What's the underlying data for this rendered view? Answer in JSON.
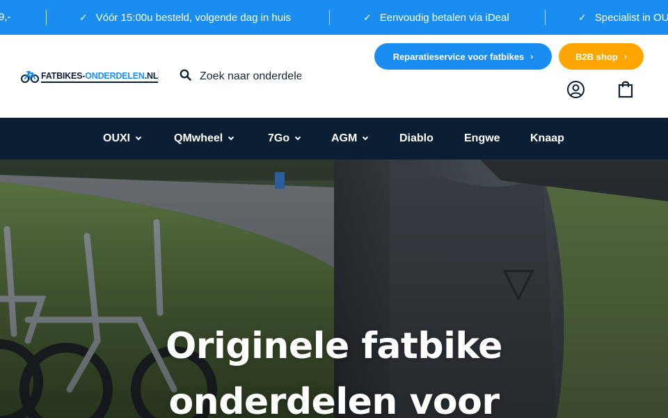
{
  "announcement": {
    "items": [
      {
        "text": "9,-"
      },
      {
        "text": "Vóór 15:00u besteld, volgende dag in huis"
      },
      {
        "text": "Eenvoudig betalen via iDeal"
      },
      {
        "text": "Specialist in OU"
      }
    ],
    "check_glyph": "✓"
  },
  "header": {
    "logo": {
      "text_part1": "FATBIKES-",
      "text_part2": "ONDERDELEN",
      "text_part3": ".NL"
    },
    "search": {
      "placeholder": "Zoek naar onderdelen"
    },
    "buttons": {
      "repair": "Reparatieservice voor fatbikes",
      "b2b": "B2B shop"
    },
    "icons": {
      "search": "search-icon",
      "account": "account-icon",
      "cart": "shopping-bag-icon"
    }
  },
  "nav": {
    "items": [
      {
        "label": "OUXI",
        "has_dropdown": true
      },
      {
        "label": "QMwheel",
        "has_dropdown": true
      },
      {
        "label": "7Go",
        "has_dropdown": true
      },
      {
        "label": "AGM",
        "has_dropdown": true
      },
      {
        "label": "Diablo",
        "has_dropdown": false
      },
      {
        "label": "Engwe",
        "has_dropdown": false
      },
      {
        "label": "Knaap",
        "has_dropdown": false
      }
    ]
  },
  "hero": {
    "title_line1": "Originele fatbike",
    "title_line2": "onderdelen voor"
  },
  "colors": {
    "announce_bg": "#1a8ef0",
    "nav_bg": "#0a1f33",
    "primary": "#1a8ef0",
    "b2b": "#ffa500",
    "text_dark": "#0c1f33"
  }
}
